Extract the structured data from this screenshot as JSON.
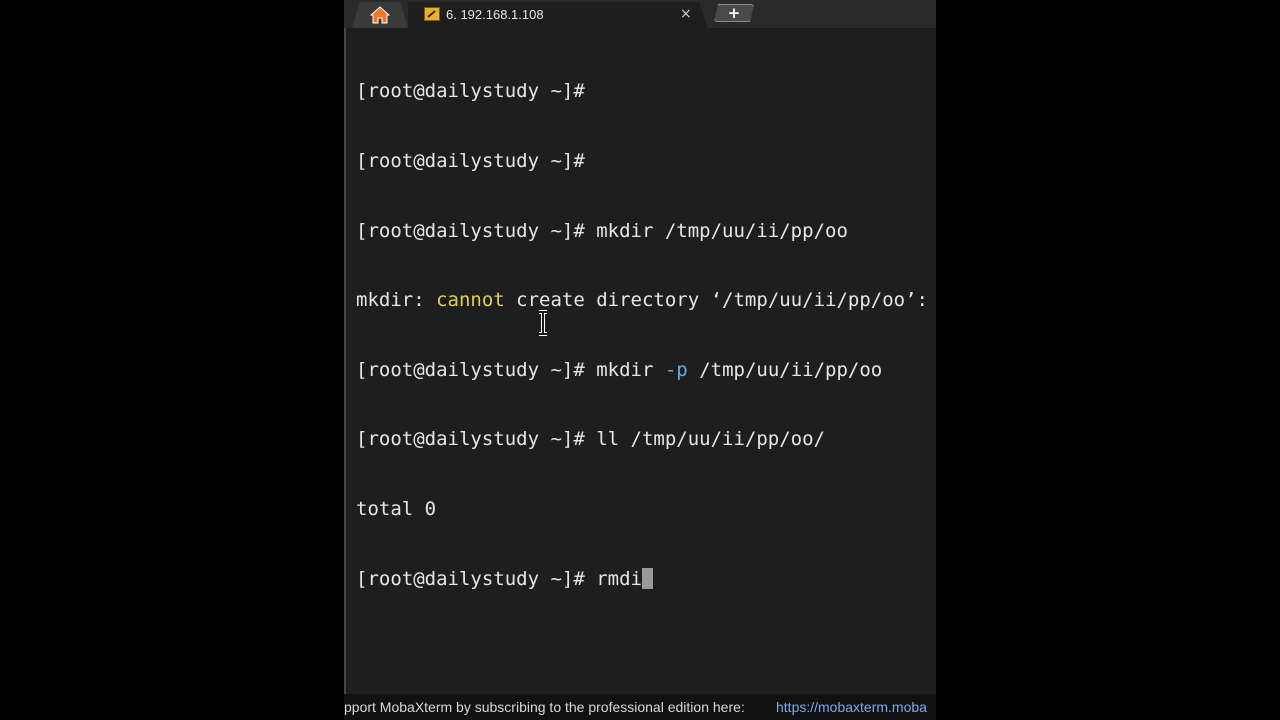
{
  "tabs": {
    "home_icon": "home-icon",
    "session_icon": "session-icon",
    "session_label": "6. 192.168.1.108",
    "close_label": "×",
    "new_tab_label": "+"
  },
  "terminal": {
    "lines": [
      {
        "prompt": "[root@dailystudy ~]#",
        "cmd": ""
      },
      {
        "prompt": "[root@dailystudy ~]#",
        "cmd": ""
      },
      {
        "prompt": "[root@dailystudy ~]#",
        "cmd": " mkdir /tmp/uu/ii/pp/oo"
      },
      {
        "output_a": "mkdir: ",
        "output_yellow": "cannot",
        "output_b": " create directory ‘/tmp/uu/ii/pp/oo’:"
      },
      {
        "prompt": "[root@dailystudy ~]#",
        "cmd_a": " mkdir ",
        "cmd_blue": "-p",
        "cmd_b": " /tmp/uu/ii/pp/oo"
      },
      {
        "prompt": "[root@dailystudy ~]#",
        "cmd": " ll /tmp/uu/ii/pp/oo/"
      },
      {
        "output": "total 0"
      },
      {
        "prompt": "[root@dailystudy ~]#",
        "cmd": " rmdi"
      }
    ],
    "colors": {
      "background": "#1e1e1e",
      "text": "#e6e6e6",
      "yellow": "#e0d050",
      "blue": "#5fb0e0"
    }
  },
  "statusbar": {
    "message": "pport MobaXterm by subscribing to the professional edition here:",
    "link": "https://mobaxterm.moba"
  }
}
